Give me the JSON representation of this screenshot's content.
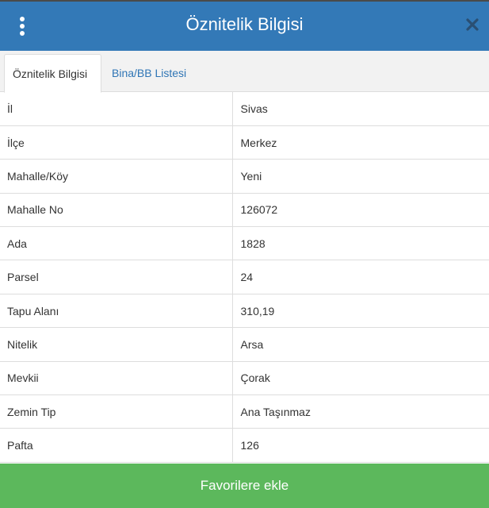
{
  "header": {
    "title": "Öznitelik Bilgisi",
    "menu_icon": "kebab-menu-icon",
    "close_icon": "close-icon",
    "color": "#3379b7"
  },
  "tabs": [
    {
      "label": "Öznitelik Bilgisi",
      "active": true
    },
    {
      "label": "Bina/BB Listesi",
      "active": false
    }
  ],
  "attributes": [
    {
      "key": "İl",
      "value": "Sivas"
    },
    {
      "key": "İlçe",
      "value": "Merkez"
    },
    {
      "key": "Mahalle/Köy",
      "value": "Yeni"
    },
    {
      "key": "Mahalle No",
      "value": "126072"
    },
    {
      "key": "Ada",
      "value": "1828"
    },
    {
      "key": "Parsel",
      "value": "24"
    },
    {
      "key": "Tapu Alanı",
      "value": "310,19"
    },
    {
      "key": "Nitelik",
      "value": "Arsa"
    },
    {
      "key": "Mevkii",
      "value": "Çorak"
    },
    {
      "key": "Zemin Tip",
      "value": "Ana Taşınmaz"
    },
    {
      "key": "Pafta",
      "value": "126"
    }
  ],
  "footer": {
    "button_label": "Favorilere ekle",
    "color": "#5cb85c"
  }
}
